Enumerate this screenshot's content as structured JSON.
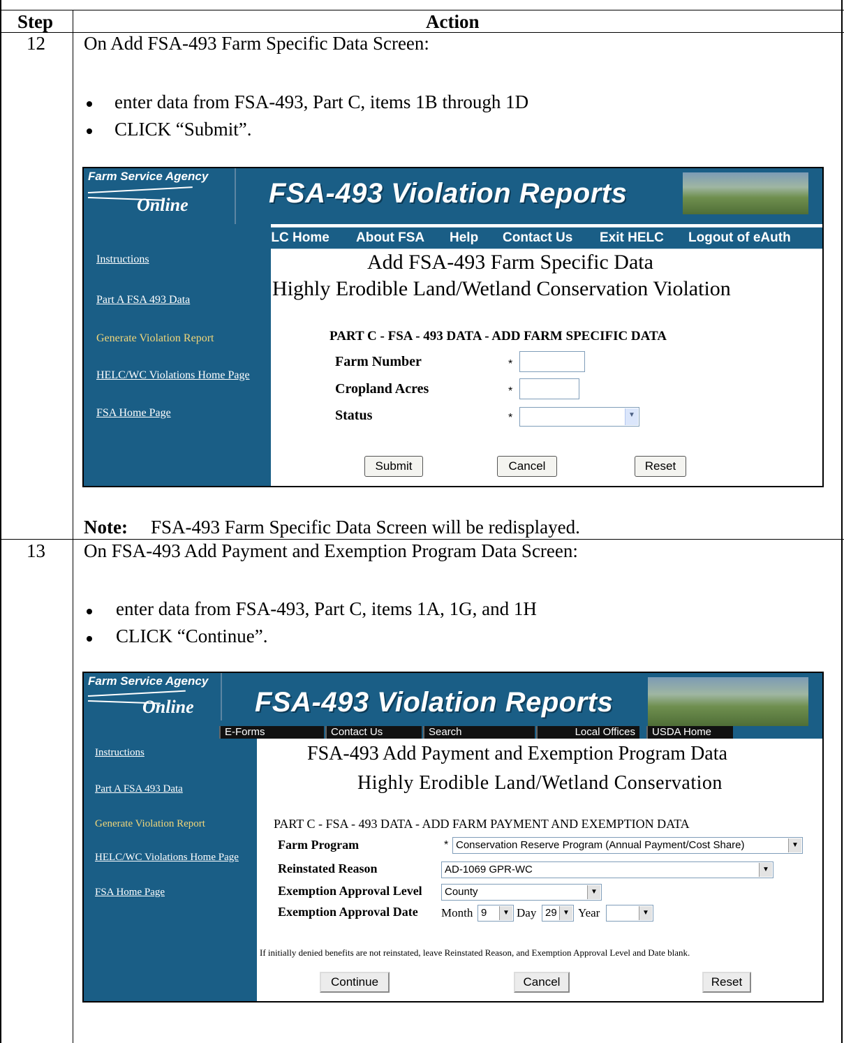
{
  "table": {
    "col_step": "Step",
    "col_action": "Action"
  },
  "step12": {
    "number": "12",
    "intro": "On Add FSA-493 Farm Specific Data Screen:",
    "bullets": [
      "enter data from FSA-493, Part C, items 1B through 1D",
      "CLICK “Submit”."
    ],
    "note_label": "Note:",
    "note_text": "FSA-493 Farm Specific Data Screen will be redisplayed.",
    "screen": {
      "logo_top": "Farm Service Agency",
      "logo_bottom": "Online",
      "banner_title": "FSA-493 Violation Reports",
      "nav": [
        "HELC Home",
        "About FSA",
        "Help",
        "Contact Us",
        "Exit HELC",
        "Logout of eAuth"
      ],
      "sidebar": [
        "Instructions",
        "Part A FSA 493 Data",
        "Generate Violation Report",
        "HELC/WC Violations Home Page",
        "FSA Home Page"
      ],
      "title_line1": "Add FSA-493 Farm Specific Data",
      "title_line2": "Highly Erodible Land/Wetland Conservation Violation",
      "part_heading": "PART C - FSA - 493 DATA - ADD FARM SPECIFIC DATA",
      "fields": [
        {
          "label": "Farm Number",
          "required": "*",
          "value": ""
        },
        {
          "label": "Cropland Acres",
          "required": "*",
          "value": ""
        },
        {
          "label": "Status",
          "required": "*",
          "value": ""
        }
      ],
      "buttons": [
        "Submit",
        "Cancel",
        "Reset"
      ]
    }
  },
  "step13": {
    "number": "13",
    "intro": "On FSA-493 Add Payment and Exemption Program Data Screen:",
    "bullets": [
      "enter data from FSA-493, Part C, items 1A, 1G, and 1H",
      "CLICK “Continue”."
    ],
    "screen": {
      "logo_top": "Farm Service Agency",
      "logo_bottom": "Online",
      "banner_title": "FSA-493 Violation Reports",
      "tabs": [
        "E-Forms",
        "Contact Us",
        "Search",
        "Local Offices",
        "USDA Home"
      ],
      "sidebar": [
        "Instructions",
        "Part A FSA 493 Data",
        "Generate Violation Report",
        "HELC/WC Violations Home Page",
        "FSA Home Page"
      ],
      "title_line1": "FSA-493 Add Payment and Exemption Program Data",
      "title_line2": "Highly Erodible Land/Wetland Conservation",
      "part_heading": "PART C - FSA - 493 DATA - ADD FARM PAYMENT AND EXEMPTION DATA",
      "farm_program_label": "Farm Program",
      "farm_program_required": "*",
      "farm_program_value": "Conservation Reserve Program (Annual Payment/Cost Share)",
      "reinstated_label": "Reinstated Reason",
      "reinstated_value": "AD-1069 GPR-WC",
      "approval_level_label": "Exemption Approval Level",
      "approval_level_value": "County",
      "approval_date_label": "Exemption Approval Date",
      "month_label": "Month",
      "month_value": "9",
      "day_label": "Day",
      "day_value": "29",
      "year_label": "Year",
      "year_value": "",
      "hint": "If initially denied benefits are not reinstated, leave Reinstated Reason, and Exemption Approval Level and Date blank.",
      "buttons": [
        "Continue",
        "Cancel",
        "Reset"
      ]
    }
  }
}
